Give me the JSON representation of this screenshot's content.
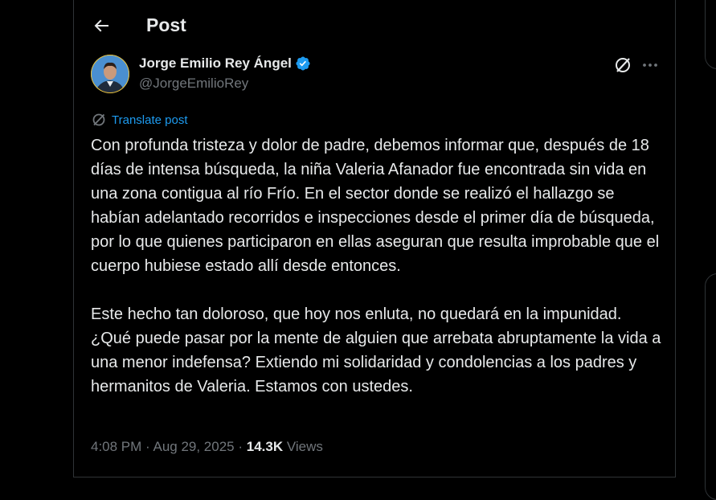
{
  "header": {
    "title": "Post"
  },
  "author": {
    "name": "Jorge Emilio Rey Ángel",
    "handle": "@JorgeEmilioRey",
    "verified_color": "#1d9bf0"
  },
  "translate": {
    "label": "Translate post"
  },
  "post": {
    "paragraph_1": "Con profunda tristeza y dolor de padre, debemos informar que, después de 18 días de intensa búsqueda, la niña Valeria Afanador fue encontrada sin vida en una zona contigua al río Frío. En el sector donde se realizó el hallazgo se habían adelantado recorridos e inspecciones desde el primer día de búsqueda, por lo que quienes participaron en ellas aseguran que resulta improbable que el cuerpo hubiese estado allí desde entonces.",
    "paragraph_2": "Este hecho tan doloroso, que hoy nos enluta, no quedará en la impunidad. ¿Qué puede pasar por la mente de alguien que arrebata abruptamente la vida a una menor indefensa? Extiendo mi solidaridad y condolencias a los padres y hermanitos de Valeria. Estamos con ustedes."
  },
  "meta": {
    "time": "4:08 PM",
    "separator_1": " · ",
    "date": "Aug 29, 2025",
    "separator_2": " · ",
    "views_count": "14.3K",
    "views_label": " Views"
  },
  "icons": {
    "back": "arrow-left-icon",
    "verified": "verified-badge-icon",
    "grok": "grok-icon",
    "more": "more-icon",
    "translate": "translate-icon"
  }
}
